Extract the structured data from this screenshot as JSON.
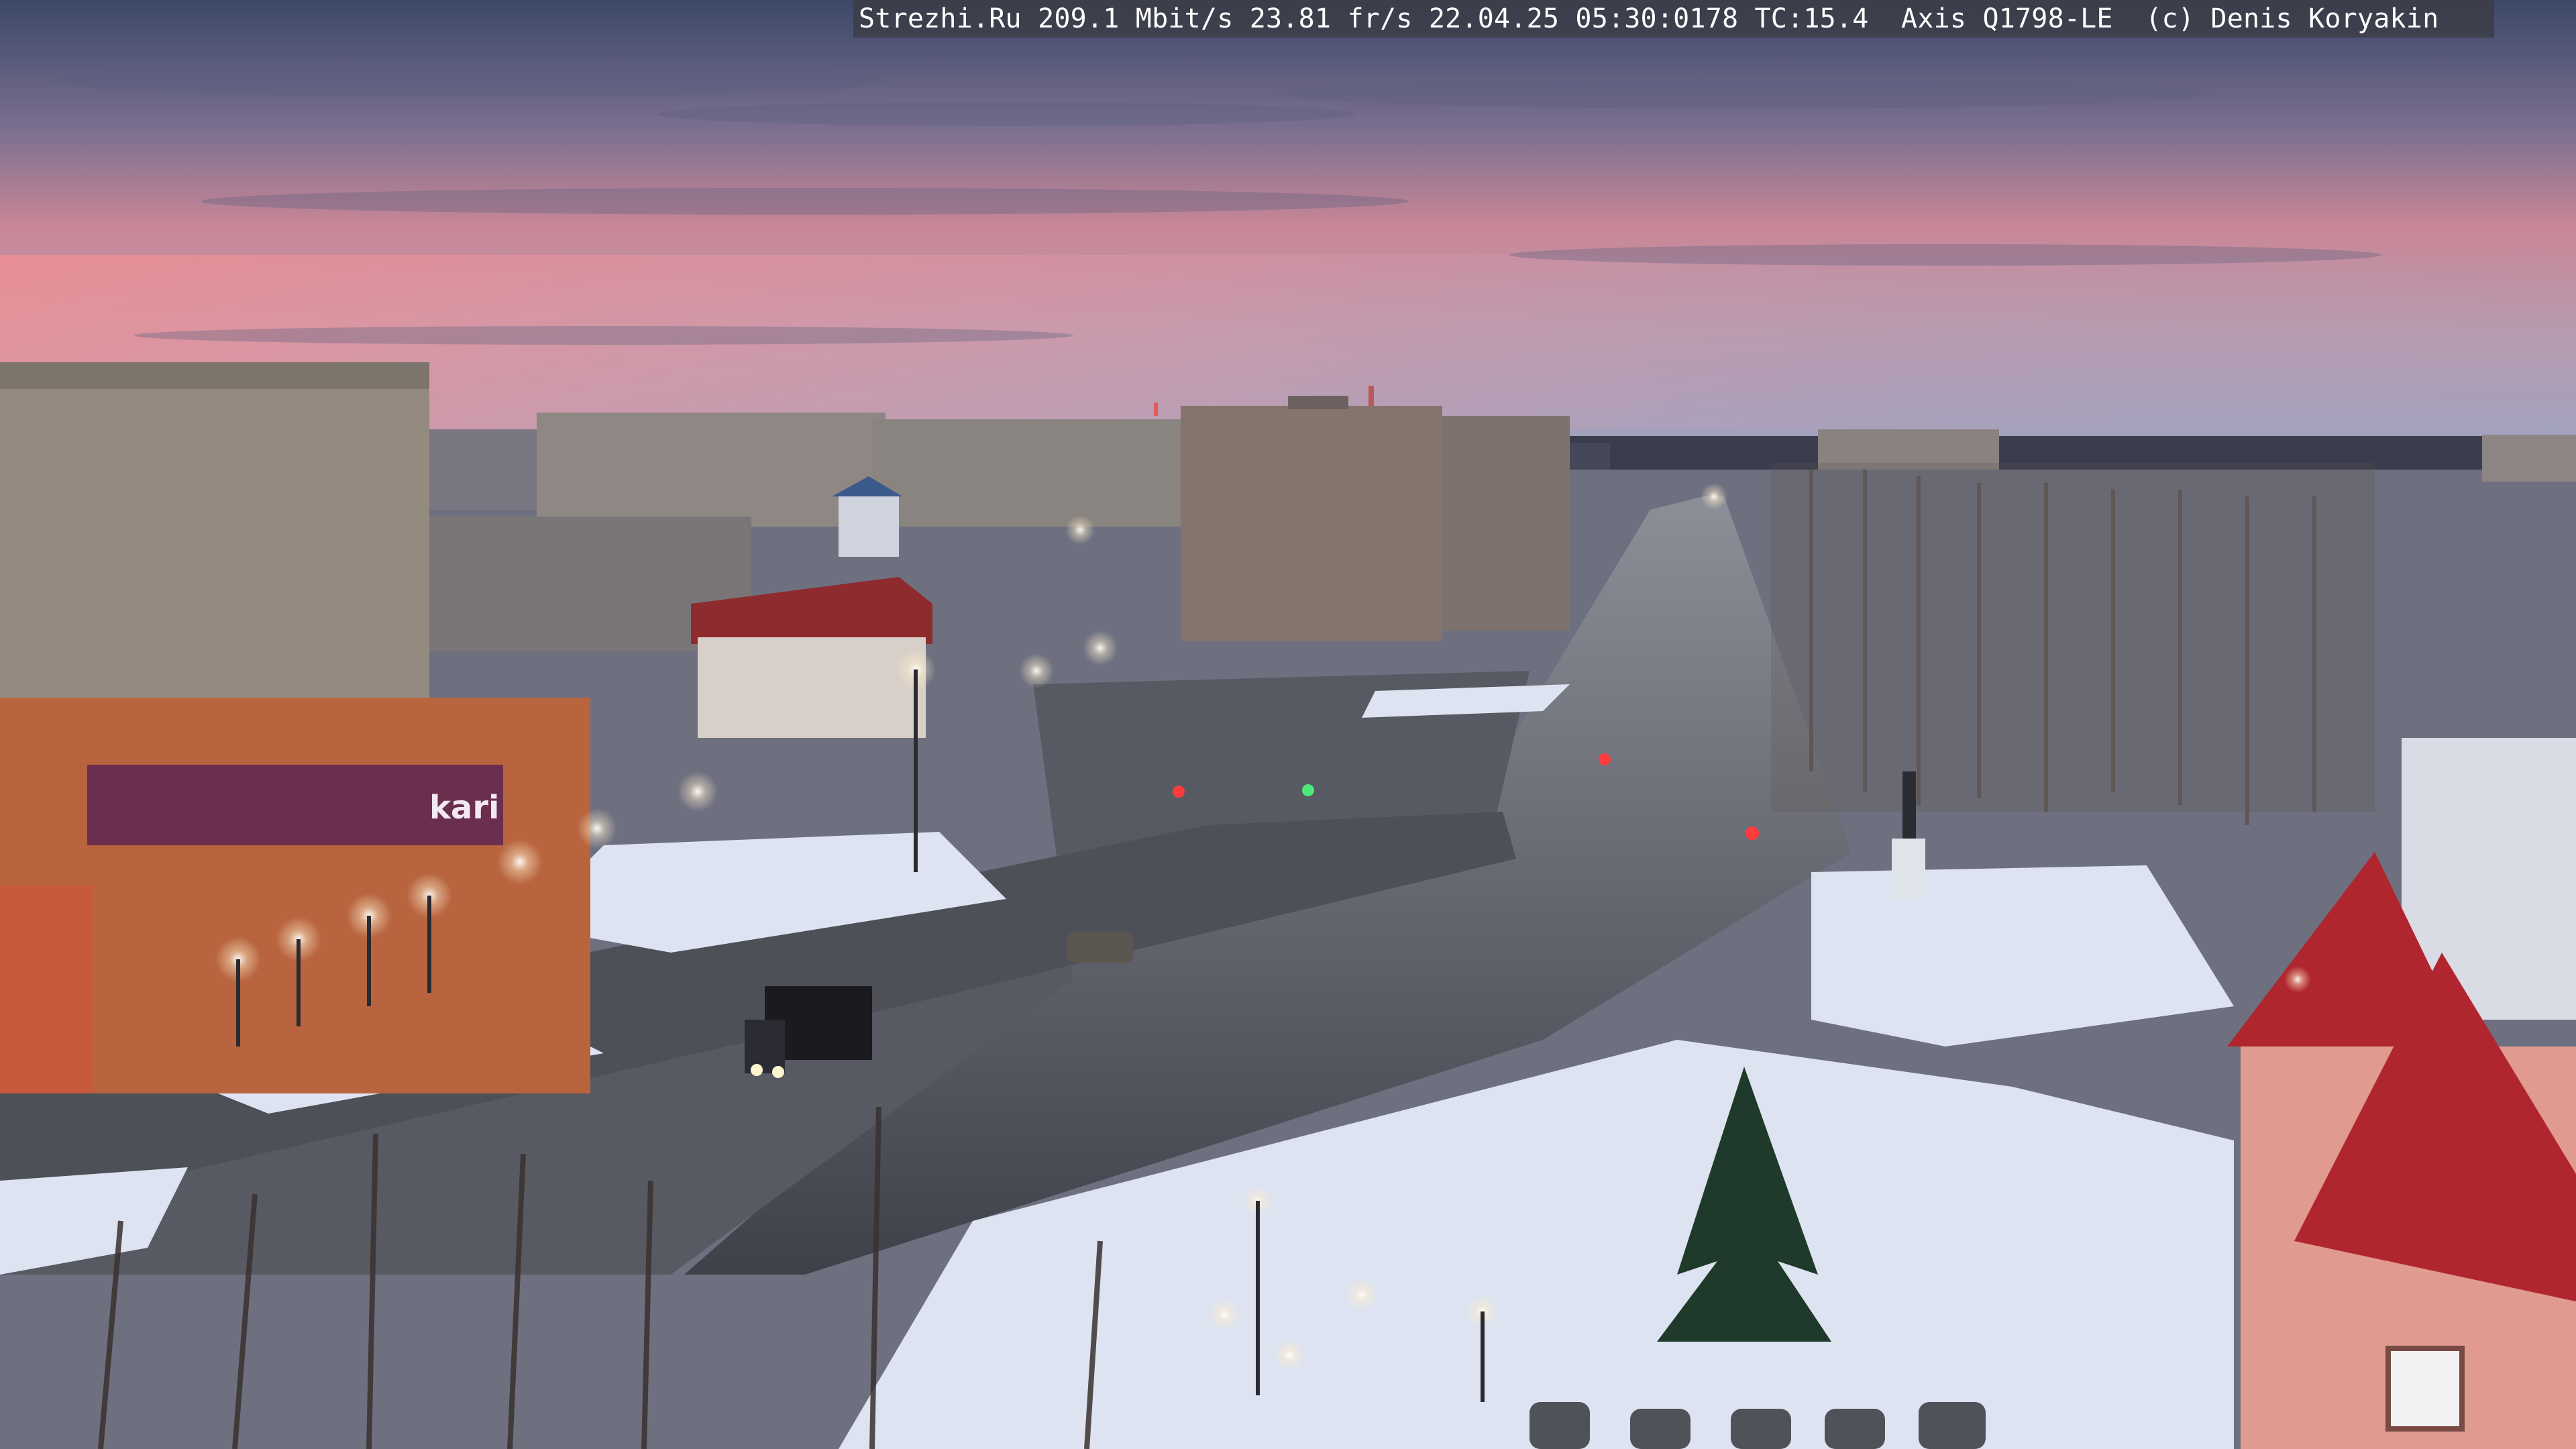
{
  "overlay": {
    "text": "Strezhi.Ru 209.1 Mbit/s 23.81 fr/s 22.04.25 05:30:0178 TC:15.4  Axis Q1798-LE  (c) Denis Koryakin"
  },
  "signage": {
    "store_sign": "kari"
  },
  "colors": {
    "sky_top": "#3c4868",
    "sky_pink": "#d88a9a",
    "sky_horizon": "#a9a8c6",
    "snow": "#dfe4f0",
    "road": "#4a4c55",
    "red_roof": "#b0262e"
  }
}
